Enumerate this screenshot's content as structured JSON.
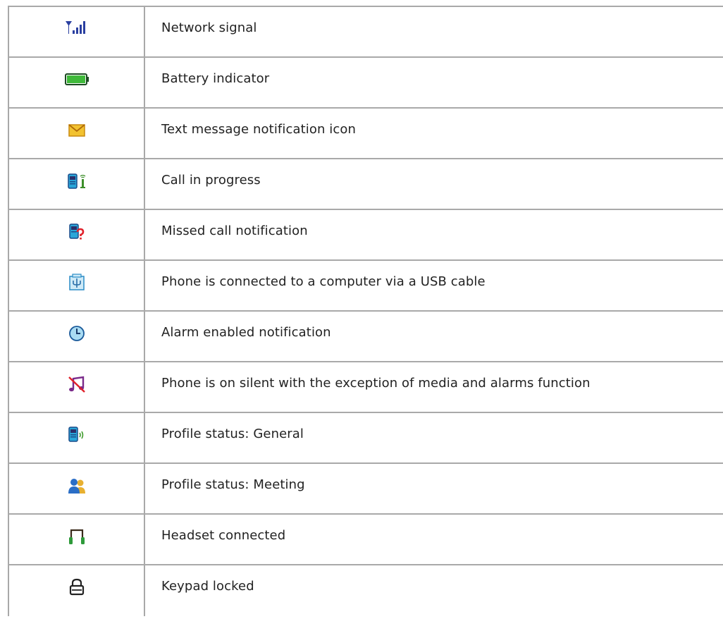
{
  "rows": [
    {
      "icon": "network-signal-icon",
      "label": "Network signal"
    },
    {
      "icon": "battery-icon",
      "label": "Battery indicator"
    },
    {
      "icon": "envelope-icon",
      "label": "Text message notification icon"
    },
    {
      "icon": "call-in-progress-icon",
      "label": "Call in progress"
    },
    {
      "icon": "missed-call-icon",
      "label": "Missed call notification"
    },
    {
      "icon": "usb-icon",
      "label": "Phone is connected to a computer via a USB cable"
    },
    {
      "icon": "alarm-clock-icon",
      "label": "Alarm enabled notification"
    },
    {
      "icon": "silent-icon",
      "label": "Phone is on silent with the exception of media and alarms function"
    },
    {
      "icon": "profile-general-icon",
      "label": "Profile status: General"
    },
    {
      "icon": "profile-meeting-icon",
      "label": "Profile status: Meeting"
    },
    {
      "icon": "headset-icon",
      "label": "Headset connected"
    },
    {
      "icon": "padlock-icon",
      "label": "Keypad locked"
    }
  ],
  "colors": {
    "border": "#a9a9a9",
    "signal": "#2a3fa0",
    "battery": "#3fb93a",
    "envelope": "#f2c230",
    "phone": "#2aa6d8",
    "alert_red": "#e0202a",
    "headset": "#2e9a3a"
  }
}
